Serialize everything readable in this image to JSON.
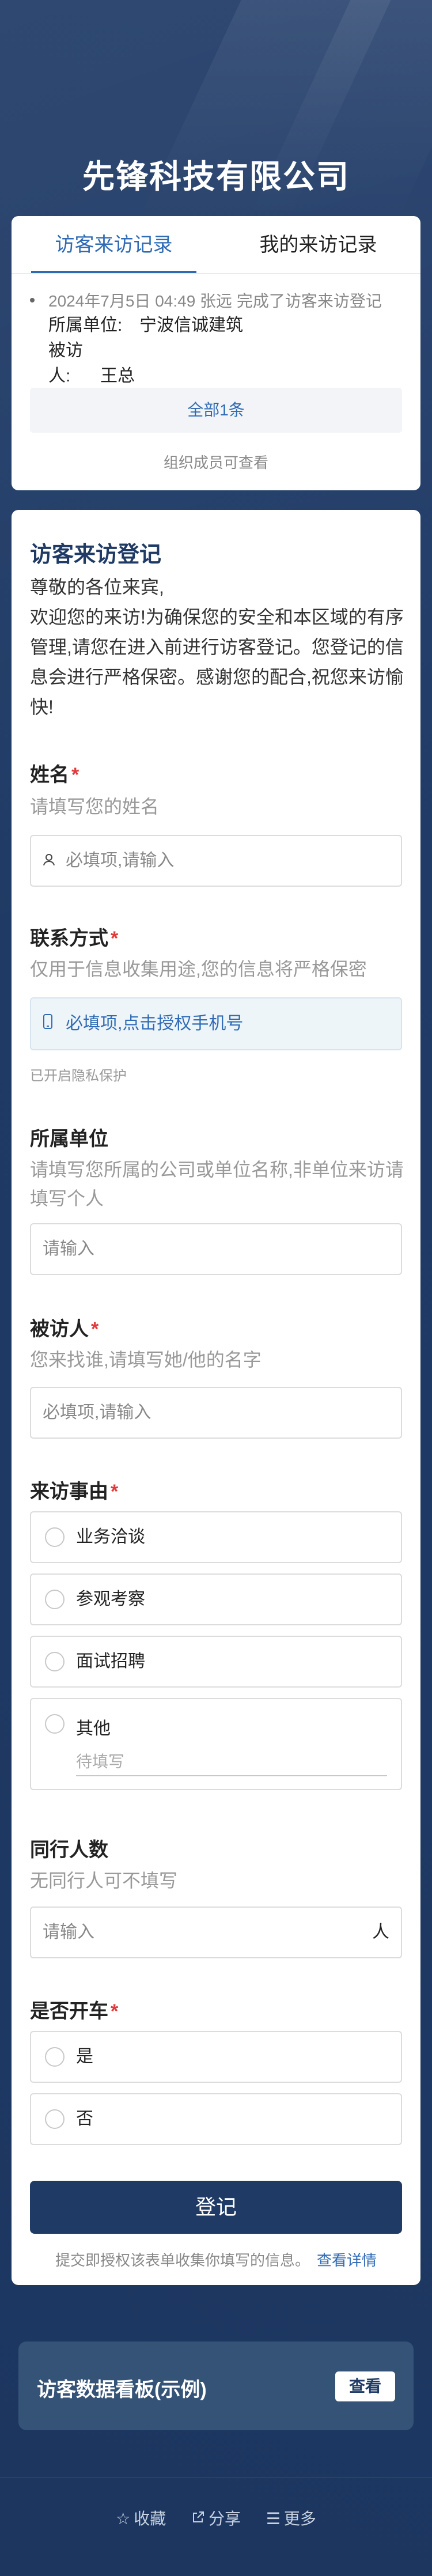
{
  "header": {
    "company": "先锋科技有限公司"
  },
  "records": {
    "tabs": [
      "访客来访记录",
      "我的来访记录"
    ],
    "entry": {
      "meta": "2024年7月5日 04:49  张远  完成了访客来访登记",
      "company_label": "所属单位:",
      "company_value": "宁波信诚建筑",
      "host_label": "被访人:",
      "host_value": "王总"
    },
    "total": "全部1条",
    "visibility_note": "组织成员可查看"
  },
  "form": {
    "title": "访客来访登记",
    "intro": "尊敬的各位来宾,\n欢迎您的来访!为确保您的安全和本区域的有序管理,请您在进入前进行访客登记。您登记的信息会进行严格保密。感谢您的配合,祝您来访愉快!",
    "name": {
      "label": "姓名",
      "hint": "请填写您的姓名",
      "placeholder": "必填项,请输入",
      "icon": "user-icon"
    },
    "contact": {
      "label": "联系方式",
      "hint": "仅用于信息收集用途,您的信息将严格保密",
      "button": "必填项,点击授权手机号",
      "icon": "phone-icon",
      "privacy": "已开启隐私保护"
    },
    "company": {
      "label": "所属单位",
      "hint": "请填写您所属的公司或单位名称,非单位来访请填写个人",
      "placeholder": "请输入"
    },
    "host": {
      "label": "被访人",
      "hint": "您来找谁,请填写她/他的名字",
      "placeholder": "必填项,请输入"
    },
    "reason": {
      "label": "来访事由",
      "options": [
        "业务洽谈",
        "参观考察",
        "面试招聘",
        "其他"
      ],
      "other_placeholder": "待填写"
    },
    "companions": {
      "label": "同行人数",
      "hint": "无同行人可不填写",
      "placeholder": "请输入",
      "unit": "人"
    },
    "driving": {
      "label": "是否开车",
      "options": [
        "是",
        "否"
      ]
    },
    "required_mark": "*",
    "submit": "登记",
    "consent": "提交即授权该表单收集你填写的信息。",
    "consent_link": "查看详情"
  },
  "dashboard": {
    "title": "访客数据看板(示例)",
    "button": "查看"
  },
  "footer": {
    "items": [
      {
        "label": "收藏",
        "icon": "star-icon"
      },
      {
        "label": "分享",
        "icon": "share-icon"
      },
      {
        "label": "更多",
        "icon": "menu-icon"
      }
    ]
  },
  "colors": {
    "brand": "#1f3b65",
    "accent": "#2f6bb5",
    "required": "#e03a3a"
  }
}
